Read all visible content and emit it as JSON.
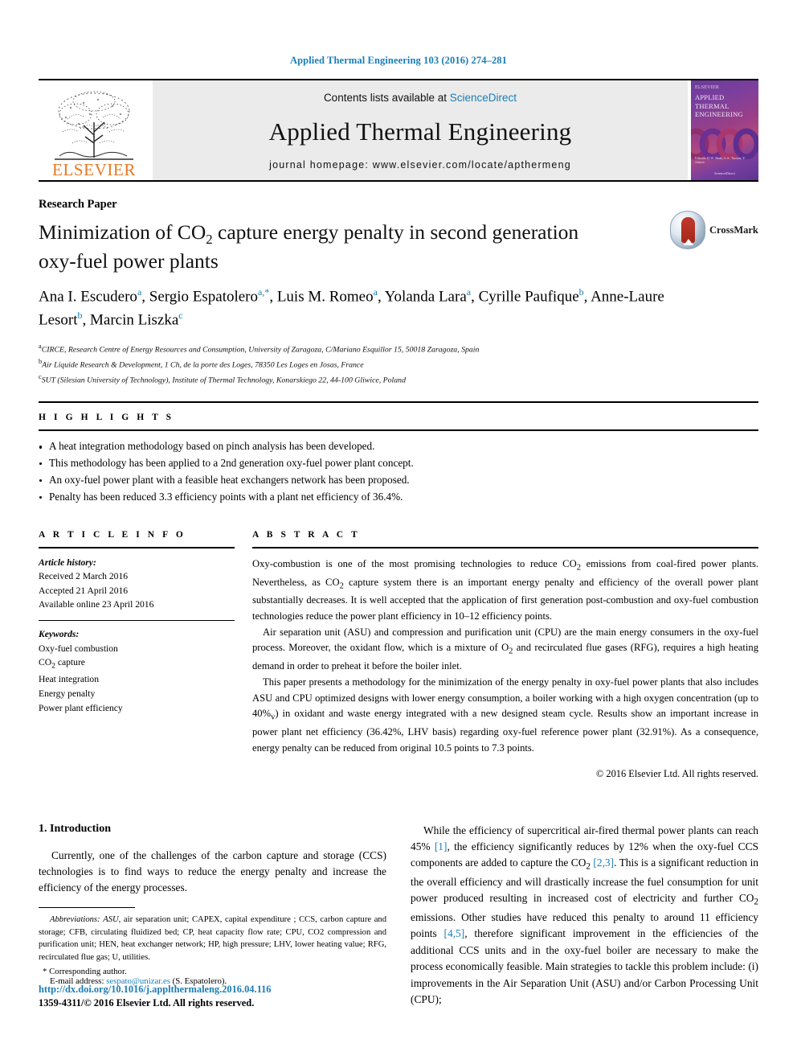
{
  "running_head": "Applied Thermal Engineering 103 (2016) 274–281",
  "masthead": {
    "contents_prefix": "Contents lists available at ",
    "sciencedirect": "ScienceDirect",
    "journal_title": "Applied Thermal Engineering",
    "homepage": "journal homepage: www.elsevier.com/locate/apthermeng",
    "publisher_wordmark": "ELSEVIER",
    "cover": {
      "line1": "APPLIED",
      "line2": "THERMAL",
      "line3": "ENGINEERING",
      "publisher_small": "ELSEVIER",
      "editors": "Editors: D.W. Reay, S.A. Tassou, Y. Jaluria",
      "footer": "ScienceDirect"
    },
    "accent_color": "#1a7db6",
    "elsevier_orange": "#e87722"
  },
  "article": {
    "type": "Research Paper",
    "title_part1": "Minimization of CO",
    "title_sub": "2",
    "title_part2": " capture energy penalty in second generation oxy-fuel power plants",
    "crossmark_label": "CrossMark",
    "authors_line1": "Ana I. Escudero",
    "authors": [
      {
        "name": "Ana I. Escudero",
        "sup": "a"
      },
      {
        "name": "Sergio Espatolero",
        "sup": "a,*"
      },
      {
        "name": "Luis M. Romeo",
        "sup": "a"
      },
      {
        "name": "Yolanda Lara",
        "sup": "a"
      },
      {
        "name": "Cyrille Paufique",
        "sup": "b"
      },
      {
        "name": "Anne-Laure Lesort",
        "sup": "b"
      },
      {
        "name": "Marcin Liszka",
        "sup": "c"
      }
    ],
    "affiliations": [
      {
        "sup": "a",
        "text": "CIRCE, Research Centre of Energy Resources and Consumption, University of Zaragoza, C/Mariano Esquillor 15, 50018 Zaragoza, Spain"
      },
      {
        "sup": "b",
        "text": "Air Liquide Research & Development, 1 Ch, de la porte des Loges, 78350 Les Loges en Josas, France"
      },
      {
        "sup": "c",
        "text": "SUT (Silesian University of Technology), Institute of Thermal Technology, Konarskiego 22, 44-100 Gliwice, Poland"
      }
    ]
  },
  "highlights": {
    "label": "H I G H L I G H T S",
    "items": [
      "A heat integration methodology based on pinch analysis has been developed.",
      "This methodology has been applied to a 2nd generation oxy-fuel power plant concept.",
      "An oxy-fuel power plant with a feasible heat exchangers network has been proposed.",
      "Penalty has been reduced 3.3 efficiency points with a plant net efficiency of 36.4%."
    ]
  },
  "article_info": {
    "label": "A R T I C L E     I N F O",
    "history_title": "Article history:",
    "history": [
      "Received 2 March 2016",
      "Accepted 21 April 2016",
      "Available online 23 April 2016"
    ],
    "keywords_title": "Keywords:",
    "keywords_1": "Oxy-fuel combustion",
    "keywords_co2_prefix": "CO",
    "keywords_co2_sub": "2",
    "keywords_co2_suffix": " capture",
    "keywords_rest": [
      "Heat integration",
      "Energy penalty",
      "Power plant efficiency"
    ]
  },
  "abstract": {
    "label": "A B S T R A C T",
    "p1_a": "Oxy-combustion is one of the most promising technologies to reduce CO",
    "p1_b": "2",
    "p1_c": " emissions from coal-fired power plants. Nevertheless, as CO",
    "p1_d": "2",
    "p1_e": " capture system there is an important energy penalty and efficiency of the overall power plant substantially decreases. It is well accepted that the application of first generation post-combustion and oxy-fuel combustion technologies reduce the power plant efficiency in 10–12 efficiency points.",
    "p2_a": "Air separation unit (ASU) and compression and purification unit (CPU) are the main energy consumers in the oxy-fuel process. Moreover, the oxidant flow, which is a mixture of O",
    "p2_b": "2",
    "p2_c": " and recirculated flue gases (RFG), requires a high heating demand in order to preheat it before the boiler inlet.",
    "p3_a": "This paper presents a methodology for the minimization of the energy penalty in oxy-fuel power plants that also includes ASU and CPU optimized designs with lower energy consumption, a boiler working with a high oxygen concentration (up to 40%",
    "p3_b": "v",
    "p3_c": ") in oxidant and waste energy integrated with a new designed steam cycle. Results show an important increase in power plant net efficiency (36.42%, LHV basis) regarding oxy-fuel reference power plant (32.91%). As a consequence, energy penalty can be reduced from original 10.5 points to 7.3 points.",
    "copyright": "© 2016 Elsevier Ltd. All rights reserved."
  },
  "introduction": {
    "heading": "1. Introduction",
    "left_p1": "Currently, one of the challenges of the carbon capture and storage (CCS) technologies is to find ways to reduce the energy penalty and increase the efficiency of the energy processes.",
    "right_a": "While the efficiency of supercritical air-fired thermal power plants can reach 45% ",
    "right_ref1": "[1]",
    "right_b": ", the efficiency significantly reduces by 12% when the oxy-fuel CCS components are added to capture the CO",
    "right_sub1": "2",
    "right_c": " ",
    "right_ref2": "[2,3]",
    "right_d": ". This is a significant reduction in the overall efficiency and will drastically increase the fuel consumption for unit power produced resulting in increased cost of electricity and further CO",
    "right_sub2": "2",
    "right_e": " emissions. Other studies have reduced this penalty to around 11 efficiency points ",
    "right_ref3": "[4,5]",
    "right_f": ", therefore significant improvement in the efficiencies of the additional CCS units and in the oxy-fuel boiler are necessary to make the process economically feasible. Main strategies to tackle this problem include: (i) improvements in the Air Separation Unit (ASU) and/or Carbon Processing Unit (CPU);"
  },
  "footnotes": {
    "abbrev_title": "Abbreviations:",
    "abbrev_text_a": "ASU",
    "abbrev_text_full": ", air separation unit; CAPEX, capital expenditure ; CCS, carbon capture and storage; CFB, circulating fluidized bed; CP, heat capacity flow rate; CPU, CO2 compression and purification unit; HEN, heat exchanger network; HP, high pressure; LHV, lower heating value; RFG, recirculated flue gas; U, utilities.",
    "corresponding": "* Corresponding author.",
    "email_label": "E-mail address:",
    "email": "sespato@unizar.es",
    "email_suffix": " (S. Espatolero).",
    "doi": "http://dx.doi.org/10.1016/j.applthermaleng.2016.04.116",
    "issn": "1359-4311/© 2016 Elsevier Ltd. All rights reserved."
  }
}
